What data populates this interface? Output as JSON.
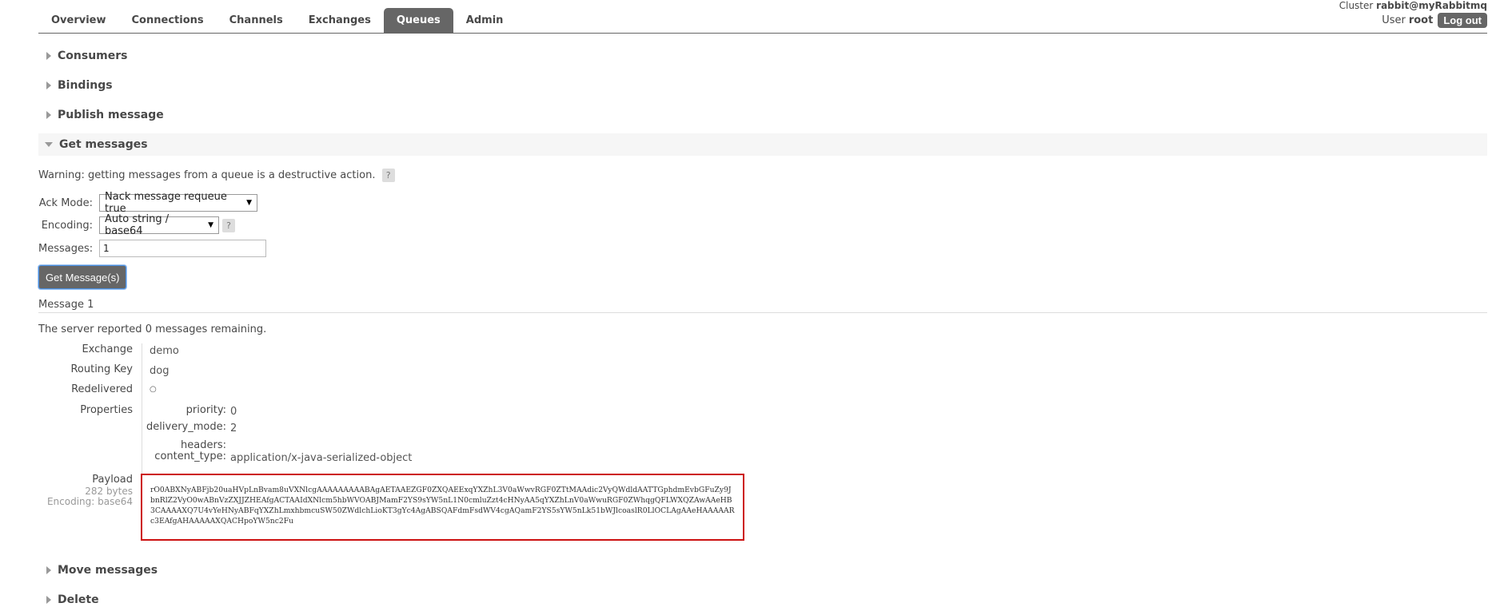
{
  "nav": {
    "tabs": [
      "Overview",
      "Connections",
      "Channels",
      "Exchanges",
      "Queues",
      "Admin"
    ],
    "active_tab": "Queues",
    "cluster_label": "Cluster",
    "cluster_name": "rabbit@myRabbitmq",
    "user_label": "User",
    "user_name": "root",
    "logout_label": "Log out"
  },
  "sections": {
    "consumers": "Consumers",
    "bindings": "Bindings",
    "publish": "Publish message",
    "get": "Get messages",
    "move": "Move messages",
    "delete": "Delete"
  },
  "get_messages": {
    "warning": "Warning: getting messages from a queue is a destructive action.",
    "help_glyph": "?",
    "ack_mode_label": "Ack Mode:",
    "ack_mode_value": "Nack message requeue true",
    "encoding_label": "Encoding:",
    "encoding_value": "Auto string / base64",
    "messages_label": "Messages:",
    "messages_value": "1",
    "button_label": "Get Message(s)"
  },
  "message": {
    "title": "Message 1",
    "server_prefix": "The server reported",
    "remaining": "0",
    "server_suffix": "messages remaining.",
    "exchange_label": "Exchange",
    "exchange_value": "demo",
    "routing_key_label": "Routing Key",
    "routing_key_value": "dog",
    "redelivered_label": "Redelivered",
    "redelivered_value": "○",
    "properties_label": "Properties",
    "properties": {
      "priority_label": "priority:",
      "priority_value": "0",
      "delivery_mode_label": "delivery_mode:",
      "delivery_mode_value": "2",
      "headers_label": "headers:",
      "headers_value": "",
      "content_type_label": "content_type:",
      "content_type_value": "application/x-java-serialized-object"
    },
    "payload_label": "Payload",
    "payload_size": "282 bytes",
    "payload_encoding": "Encoding: base64",
    "payload": "rO0ABXNyABFjb20uaHVpLnBvam8uVXNlcgAAAAAAAAABAgAETAAEZGF0ZXQAEExqYXZhL3V0aWwvRGF0ZTtMAAdic2VyQWdldAATTGphdmEvbGFuZy9JbnRlZ2VyO0wABnVzZXJJZHEAfgACTAAIdXNlcm5hbWVOABJMamF2YS9sYW5nL1N0cmluZzt4cHNyAA5qYXZhLnV0aWwuRGF0ZWhqgQFLWXQZAwAAeHB3CAAAAXQ7U4vYeHNyABFqYXZhLmxhbmcuSW50ZWdlchLioKT3gYc4AgABSQAFdmFsdWV4cgAQamF2YS5sYW5nLk51bWJlcoaslR0LlOCLAgAAeHAAAAARc3EAfgAHAAAAAXQACHpoYW5nc2Fu"
  }
}
